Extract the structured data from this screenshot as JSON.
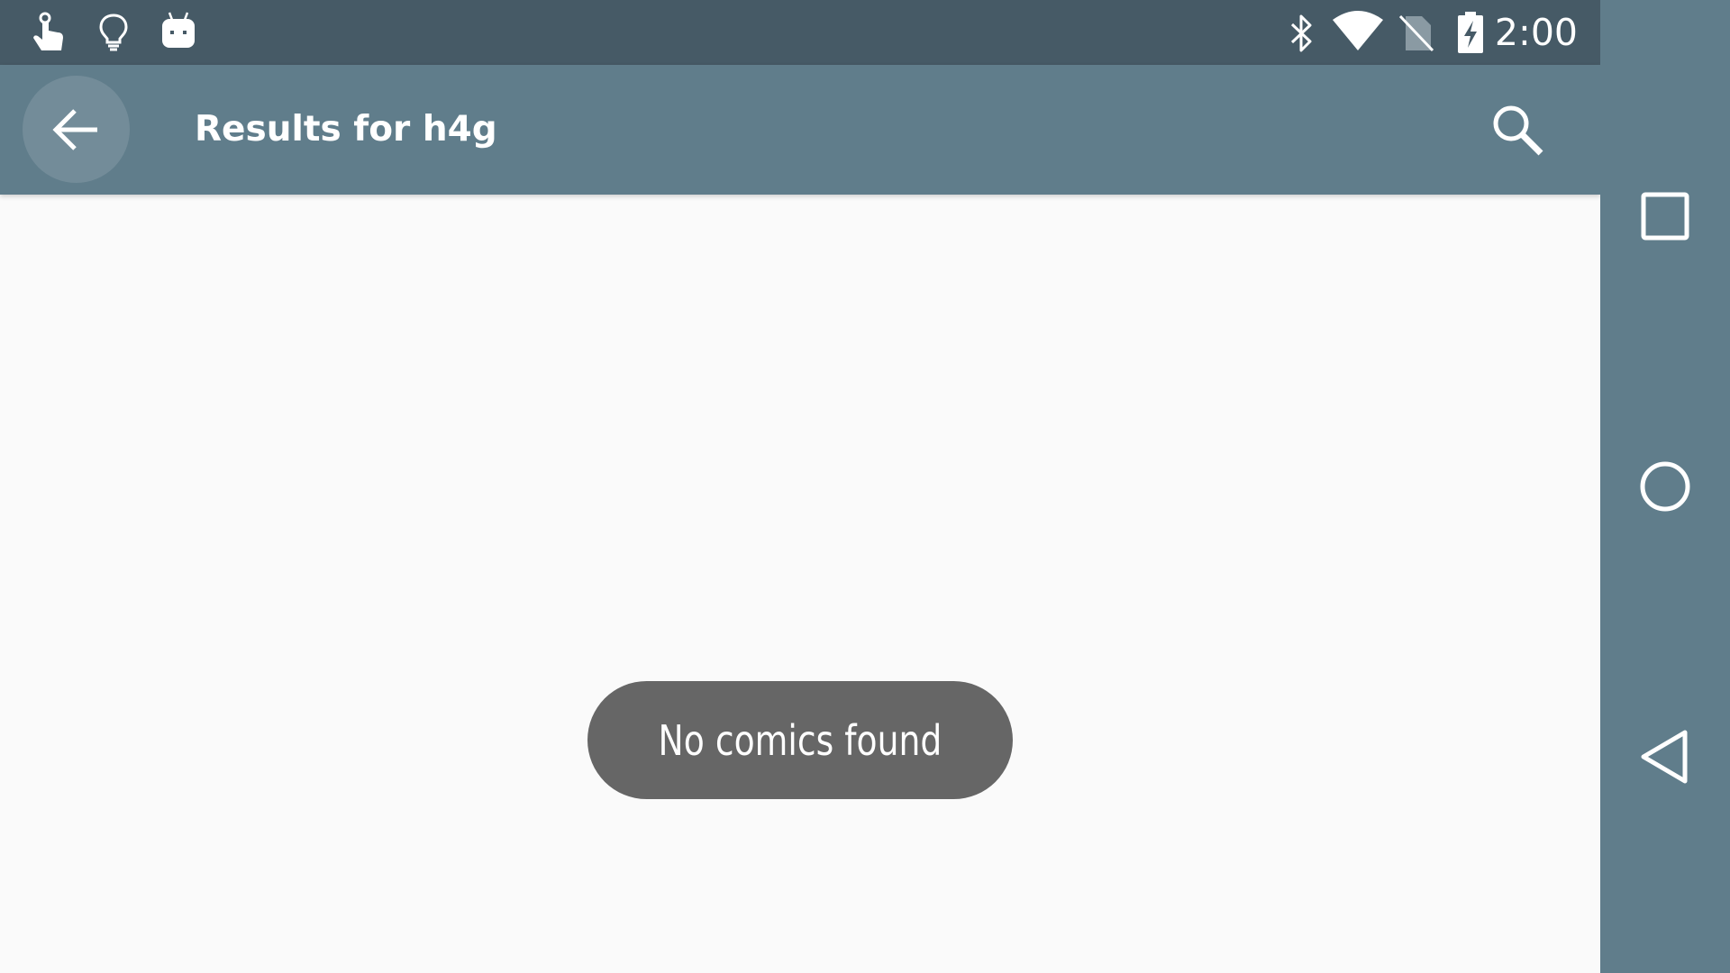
{
  "status_bar": {
    "time": "2:00",
    "left_icons": [
      "touch-icon",
      "lightbulb-icon",
      "android-icon"
    ],
    "right_icons": [
      "bluetooth-icon",
      "wifi-icon",
      "no-sim-icon",
      "battery-charging-icon"
    ]
  },
  "app_bar": {
    "title": "Results for h4g",
    "back_icon": "arrow-back-icon",
    "search_icon": "search-icon"
  },
  "toast": {
    "message": "No comics found"
  },
  "nav_bar": {
    "buttons": [
      "recents-icon",
      "home-icon",
      "back-icon"
    ]
  },
  "colors": {
    "status_bar": "#465a66",
    "app_bar": "#607d8b",
    "content_bg": "#fafafa",
    "toast_bg": "#666666"
  }
}
